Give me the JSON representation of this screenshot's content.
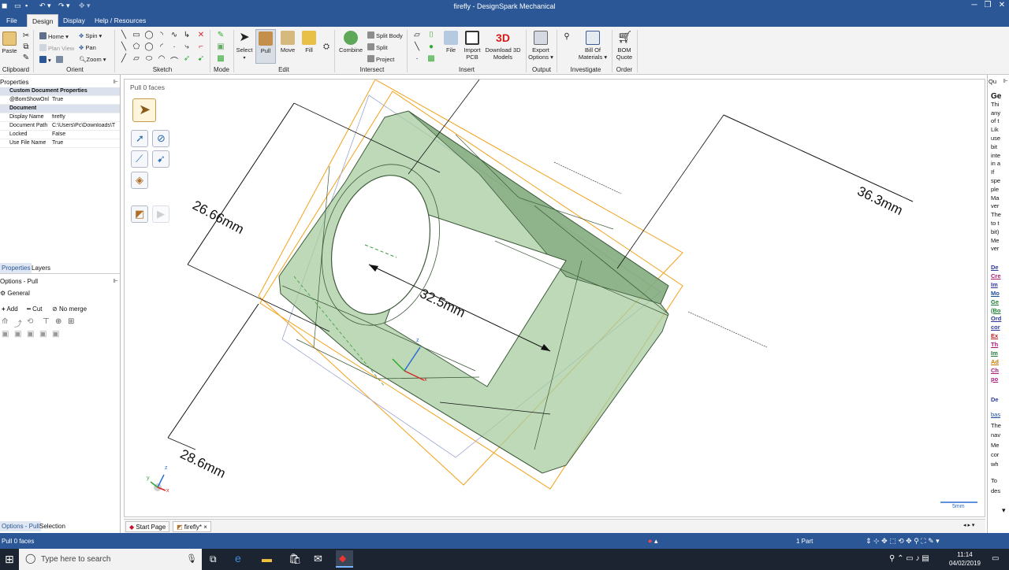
{
  "window": {
    "title": "firefly - DesignSpark Mechanical"
  },
  "menu": {
    "file": "File",
    "design": "Design",
    "display": "Display",
    "help": "Help / Resources"
  },
  "ribbon": {
    "clipboard": {
      "label": "Clipboard",
      "paste": "Paste"
    },
    "orient": {
      "label": "Orient",
      "home": "Home",
      "plan_view": "Plan View",
      "spin": "Spin",
      "pan": "Pan",
      "zoom": "Zoom"
    },
    "sketch": {
      "label": "Sketch"
    },
    "mode": {
      "label": "Mode"
    },
    "edit": {
      "label": "Edit",
      "select": "Select",
      "pull": "Pull",
      "move": "Move",
      "fill": "Fill"
    },
    "intersect": {
      "label": "Intersect",
      "combine": "Combine",
      "split_body": "Split Body",
      "split": "Split",
      "project": "Project"
    },
    "insert": {
      "label": "Insert",
      "file": "File",
      "import_pcb_1": "Import",
      "import_pcb_2": "PCB",
      "download_3d_1": "Download 3D",
      "download_3d_2": "Models"
    },
    "output": {
      "label": "Output",
      "export_1": "Export",
      "export_2": "Options"
    },
    "investigate": {
      "label": "Investigate",
      "bom_1": "Bill Of",
      "bom_2": "Materials"
    },
    "order": {
      "label": "Order",
      "quote_1": "BOM",
      "quote_2": "Quote"
    }
  },
  "properties": {
    "title": "Properties",
    "rows": [
      {
        "key": "Custom Document Properties",
        "value": "",
        "header": true
      },
      {
        "key": "@BomShowOnl",
        "value": "True",
        "header": false
      },
      {
        "key": "Document",
        "value": "",
        "header": true
      },
      {
        "key": "Display Name",
        "value": "firefly",
        "header": false
      },
      {
        "key": "Document Path",
        "value": "C:\\Users\\Pc\\Downloads\\T",
        "header": false
      },
      {
        "key": "Locked",
        "value": "False",
        "header": false
      },
      {
        "key": "Use File Name",
        "value": "True",
        "header": false
      }
    ],
    "tab_properties": "Properties",
    "tab_layers": "Layers"
  },
  "options": {
    "title": "Options - Pull",
    "general": "General",
    "add": "Add",
    "cut": "Cut",
    "no_merge": "No merge",
    "tab_options": "Options - Pull",
    "tab_selection": "Selection"
  },
  "viewport": {
    "status": "Pull 0 faces",
    "dims": {
      "d1": "26.66mm",
      "d2": "36.3mm",
      "d3": "32.5mm",
      "d4": "28.6mm"
    },
    "scale": "5mm",
    "axes": {
      "x": "x",
      "y": "y",
      "z": "z"
    }
  },
  "right_panel": {
    "title": "Qu",
    "lines": [
      "Ge",
      "Thi",
      "any",
      "of t",
      "Lik",
      "use",
      "bit",
      "inte",
      "in a",
      "If",
      "spe",
      "ple",
      "Ma",
      "ver",
      "The",
      "to t",
      "bit)",
      "Me",
      "ver"
    ],
    "links": [
      "De",
      "Cre",
      "Im",
      "Mo",
      "Ge",
      "(Bo",
      "Ord",
      "cor",
      "Ex",
      "Th",
      "Im",
      "Ad",
      "Ch",
      "po"
    ],
    "link_colors": [
      "#2f3a9e",
      "#b0167a",
      "#2f3a9e",
      "#1a4e9a",
      "#1e7d33",
      "#1e7d33",
      "#2f3a9e",
      "#2f3a9e",
      "#c01b1b",
      "#b0167a",
      "#1e7d33",
      "#c87a00",
      "#b0167a",
      "#b0167a"
    ],
    "lines2": [
      "De",
      "bas",
      "The",
      "nav",
      "Me",
      "cor",
      "wh",
      "To",
      "des"
    ]
  },
  "doc_tabs": {
    "start": "Start Page",
    "current": "firefly*"
  },
  "statusbar": {
    "left": "Pull 0 faces",
    "parts": "1 Part"
  },
  "taskbar": {
    "search": "Type here to search",
    "time": "11:14",
    "date": "04/02/2019"
  },
  "colors": {
    "accent": "#2b5797",
    "model_fill": "#9fc79a",
    "model_stroke": "#3d5a3a",
    "bbox": "#f3a21b"
  }
}
